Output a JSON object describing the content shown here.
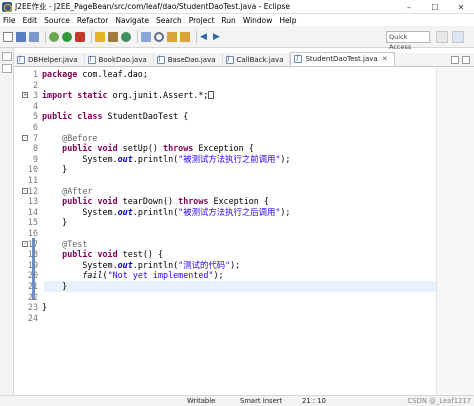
{
  "window": {
    "title": "J2EE作业 - J2EE_PageBean/src/com/leaf/dao/StudentDaoTest.java - Eclipse",
    "controls": {
      "minimize": "–",
      "maximize": "☐",
      "close": "✕"
    }
  },
  "menu": [
    "File",
    "Edit",
    "Source",
    "Refactor",
    "Navigate",
    "Search",
    "Project",
    "Run",
    "Window",
    "Help"
  ],
  "toolbar": {
    "quick_access_placeholder": "Quick Access"
  },
  "tabs": [
    {
      "label": "DBHelper.java",
      "active": false
    },
    {
      "label": "BookDao.java",
      "active": false
    },
    {
      "label": "BaseDao.java",
      "active": false
    },
    {
      "label": "CallBack.java",
      "active": false
    },
    {
      "label": "StudentDaoTest.java",
      "active": true,
      "close": "✕"
    }
  ],
  "editor": {
    "current_line": 21,
    "lines": [
      {
        "n": "1",
        "parts": [
          [
            "kw",
            "package"
          ],
          [
            "",
            " com.leaf.dao;"
          ]
        ]
      },
      {
        "n": "2",
        "parts": []
      },
      {
        "n": "3",
        "parts": [
          [
            "kw",
            "import static"
          ],
          [
            "",
            " org.junit.Assert.*;"
          ]
        ],
        "fold": "+"
      },
      {
        "n": "4",
        "parts": []
      },
      {
        "n": "5",
        "parts": [
          [
            "kw",
            "public class"
          ],
          [
            "",
            " StudentDaoTest {"
          ]
        ]
      },
      {
        "n": "6",
        "parts": []
      },
      {
        "n": "7",
        "parts": [
          [
            "",
            "    "
          ],
          [
            "ann",
            "@Before"
          ]
        ],
        "fold": "-"
      },
      {
        "n": "8",
        "parts": [
          [
            "",
            "    "
          ],
          [
            "kw",
            "public void"
          ],
          [
            "",
            " setUp() "
          ],
          [
            "kw",
            "throws"
          ],
          [
            "",
            " Exception {"
          ]
        ]
      },
      {
        "n": "9",
        "parts": [
          [
            "",
            "        System."
          ],
          [
            "sfield",
            "out"
          ],
          [
            "",
            ".println("
          ],
          [
            "str",
            "\"被测试方法执行之前调用\""
          ],
          [
            "",
            ");"
          ]
        ]
      },
      {
        "n": "10",
        "parts": [
          [
            "",
            "    }"
          ]
        ]
      },
      {
        "n": "11",
        "parts": []
      },
      {
        "n": "12",
        "parts": [
          [
            "",
            "    "
          ],
          [
            "ann",
            "@After"
          ]
        ],
        "fold": "-"
      },
      {
        "n": "13",
        "parts": [
          [
            "",
            "    "
          ],
          [
            "kw",
            "public void"
          ],
          [
            "",
            " tearDown() "
          ],
          [
            "kw",
            "throws"
          ],
          [
            "",
            " Exception {"
          ]
        ]
      },
      {
        "n": "14",
        "parts": [
          [
            "",
            "        System."
          ],
          [
            "sfield",
            "out"
          ],
          [
            "",
            ".println("
          ],
          [
            "str",
            "\"被测试方法执行之后调用\""
          ],
          [
            "",
            ");"
          ]
        ]
      },
      {
        "n": "15",
        "parts": [
          [
            "",
            "    }"
          ]
        ]
      },
      {
        "n": "16",
        "parts": []
      },
      {
        "n": "17",
        "parts": [
          [
            "",
            "    "
          ],
          [
            "ann",
            "@Test"
          ]
        ],
        "fold": "-"
      },
      {
        "n": "18",
        "parts": [
          [
            "",
            "    "
          ],
          [
            "kw",
            "public void"
          ],
          [
            "",
            " test() {"
          ]
        ]
      },
      {
        "n": "19",
        "parts": [
          [
            "",
            "        System."
          ],
          [
            "sfield",
            "out"
          ],
          [
            "",
            ".println("
          ],
          [
            "str",
            "\"测试的代码\""
          ],
          [
            "",
            ");"
          ]
        ]
      },
      {
        "n": "20",
        "parts": [
          [
            "",
            "        "
          ],
          [
            "stat",
            "fail"
          ],
          [
            "",
            "("
          ],
          [
            "str",
            "\"Not yet implemented\""
          ],
          [
            "",
            ");"
          ]
        ]
      },
      {
        "n": "21",
        "parts": [
          [
            "",
            "    }"
          ]
        ]
      },
      {
        "n": "22",
        "parts": []
      },
      {
        "n": "23",
        "parts": [
          [
            "",
            "}"
          ]
        ]
      },
      {
        "n": "24",
        "parts": []
      }
    ]
  },
  "status": {
    "writable": "Writable",
    "insert_mode": "Smart Insert",
    "position": "21 : 10",
    "watermark": "CSDN @_Leaf1217"
  }
}
